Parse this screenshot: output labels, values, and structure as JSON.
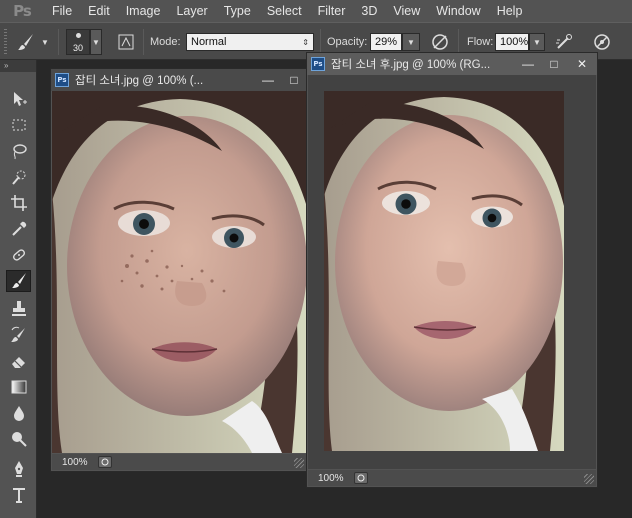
{
  "app": {
    "logo": "Ps",
    "menu": [
      "File",
      "Edit",
      "Image",
      "Layer",
      "Type",
      "Select",
      "Filter",
      "3D",
      "View",
      "Window",
      "Help"
    ]
  },
  "options": {
    "brush_size": "30",
    "mode_label": "Mode:",
    "mode_value": "Normal",
    "opacity_label": "Opacity:",
    "opacity_value": "29%",
    "flow_label": "Flow:",
    "flow_value": "100%"
  },
  "toolbar": {
    "collapse_label": "»",
    "tools": [
      {
        "name": "move-tool-icon"
      },
      {
        "name": "marquee-tool-icon"
      },
      {
        "name": "lasso-tool-icon"
      },
      {
        "name": "quick-select-tool-icon"
      },
      {
        "name": "crop-tool-icon"
      },
      {
        "name": "eyedropper-tool-icon"
      },
      {
        "name": "healing-brush-tool-icon"
      },
      {
        "name": "brush-tool-icon",
        "active": true
      },
      {
        "name": "clone-stamp-tool-icon"
      },
      {
        "name": "history-brush-tool-icon"
      },
      {
        "name": "eraser-tool-icon"
      },
      {
        "name": "gradient-tool-icon"
      },
      {
        "name": "blur-tool-icon"
      },
      {
        "name": "dodge-tool-icon"
      },
      {
        "name": "pen-tool-icon"
      },
      {
        "name": "type-tool-icon"
      }
    ]
  },
  "documents": [
    {
      "badge": "Ps",
      "title": "잡티 소녀.jpg @ 100% (...",
      "zoom": "100%",
      "buttons": {
        "minimize": "—",
        "maximize": "□",
        "close": "✕"
      }
    },
    {
      "badge": "Ps",
      "title": "잡티 소녀 후.jpg @ 100% (RG...",
      "zoom": "100%",
      "buttons": {
        "minimize": "—",
        "maximize": "□",
        "close": "✕"
      }
    }
  ],
  "colors": {
    "chrome": "#535353",
    "optionsbar": "#494949",
    "workspace": "#282828",
    "ps_blue": "#1e4d86"
  }
}
